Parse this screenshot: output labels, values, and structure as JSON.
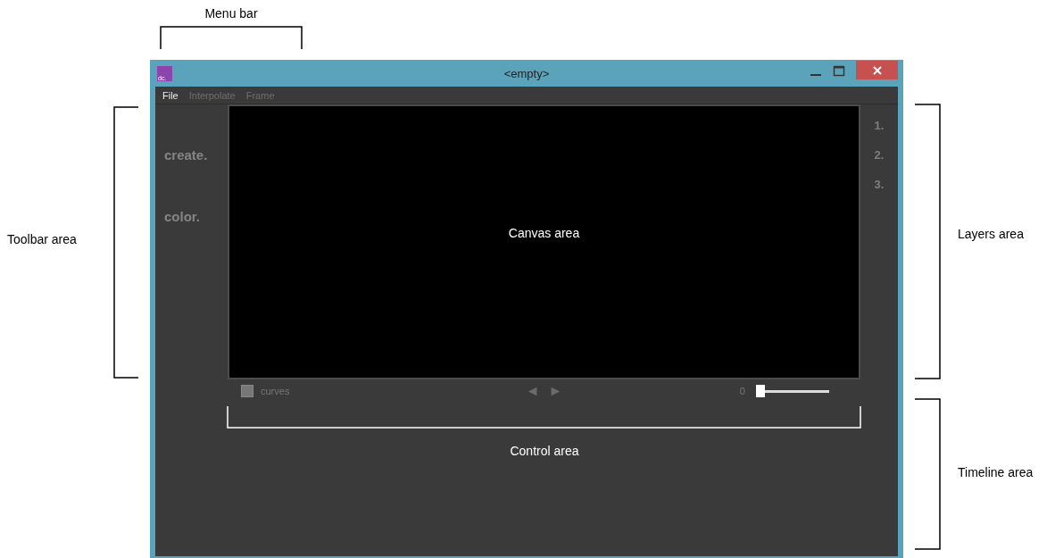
{
  "annotations": [
    {
      "label": "Menu bar",
      "kind": "top"
    },
    {
      "label": "Toolbar area",
      "kind": "left"
    },
    {
      "label": "Layers area",
      "kind": "right"
    },
    {
      "label": "Timeline area",
      "kind": "right"
    },
    {
      "label": "Control area",
      "kind": "bottom"
    }
  ],
  "window": {
    "title": "<empty>",
    "app_icon": "dc."
  },
  "menu": [
    {
      "label": "File",
      "disabled": false
    },
    {
      "label": "Interpolate",
      "disabled": true
    },
    {
      "label": "Frame",
      "disabled": true
    }
  ],
  "tools": [
    "create.",
    "color."
  ],
  "canvas": {
    "label": "Canvas area"
  },
  "layers": [
    "1.",
    "2.",
    "3."
  ],
  "controls": {
    "curves": {
      "label": "curves",
      "checked": false
    },
    "prev": "◄",
    "next": "►",
    "frame": {
      "reading": "0",
      "level": 0
    }
  }
}
